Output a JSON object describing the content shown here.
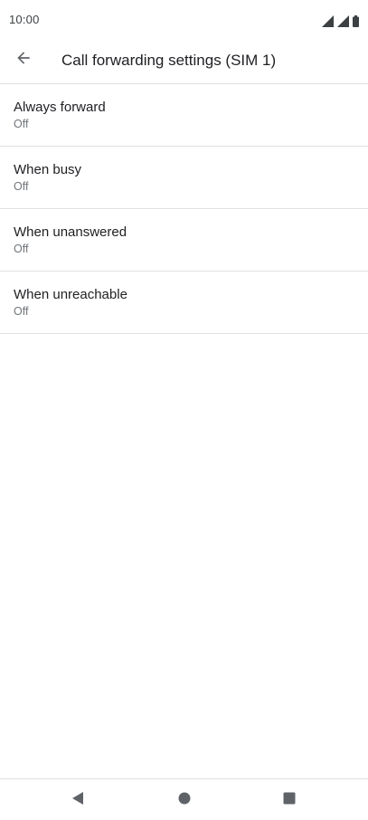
{
  "status_bar": {
    "time": "10:00",
    "icons": [
      "signal-sim1-icon",
      "signal-sim2-icon",
      "battery-icon"
    ]
  },
  "app_bar": {
    "back_icon": "arrow-back-icon",
    "title": "Call forwarding settings (SIM 1)"
  },
  "settings": {
    "items": [
      {
        "title": "Always forward",
        "summary": "Off"
      },
      {
        "title": "When busy",
        "summary": "Off"
      },
      {
        "title": "When unanswered",
        "summary": "Off"
      },
      {
        "title": "When unreachable",
        "summary": "Off"
      }
    ]
  },
  "nav_bar": {
    "icons": [
      "nav-back-icon",
      "nav-home-icon",
      "nav-recents-icon"
    ]
  },
  "colors": {
    "text_primary": "#202124",
    "text_secondary": "#70757a",
    "divider": "#e0e0e0",
    "icon": "#5f6368"
  }
}
